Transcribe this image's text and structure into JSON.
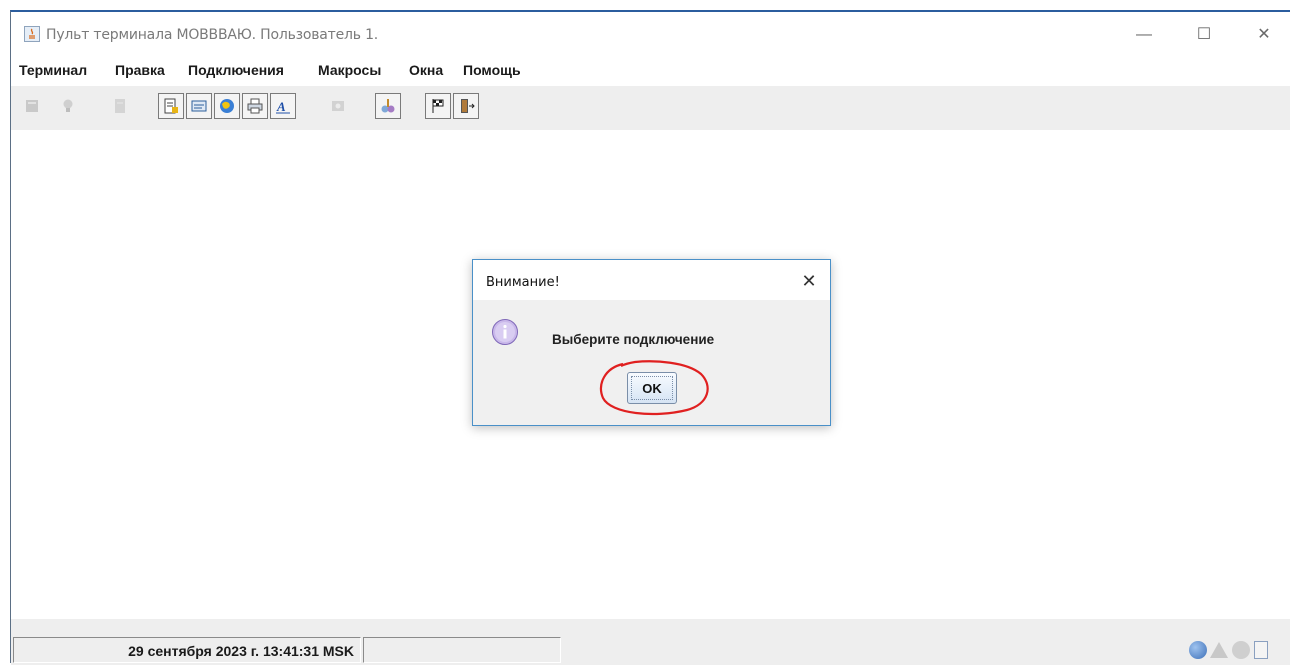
{
  "window": {
    "title": "Пульт терминала MOBBBAЮ. Пользователь 1.",
    "minimize_glyph": "—",
    "maximize_glyph": "☐",
    "close_glyph": "✕"
  },
  "menu": {
    "items": [
      "Терминал",
      "Правка",
      "Подключения",
      "Макросы",
      "Окна",
      "Помощь"
    ]
  },
  "toolbar": {
    "buttons": [
      {
        "icon": "connect-icon",
        "enabled": false
      },
      {
        "icon": "lightbulb-icon",
        "enabled": false
      },
      {
        "icon": "document-icon",
        "enabled": false
      },
      {
        "icon": "report-icon",
        "enabled": true
      },
      {
        "icon": "window-icon",
        "enabled": true
      },
      {
        "icon": "globe-icon",
        "enabled": true
      },
      {
        "icon": "printer-icon",
        "enabled": true
      },
      {
        "icon": "font-icon",
        "enabled": true
      },
      {
        "icon": "network-icon",
        "enabled": false
      },
      {
        "icon": "tools-icon",
        "enabled": true
      },
      {
        "icon": "flags-icon",
        "enabled": true
      },
      {
        "icon": "exit-icon",
        "enabled": true
      }
    ]
  },
  "status": {
    "datetime": "29 сентября 2023 г. 13:41:31 MSK",
    "icons": [
      "info-icon",
      "warning-icon",
      "error-icon",
      "log-icon"
    ]
  },
  "dialog": {
    "title": "Внимание!",
    "close_glyph": "✕",
    "message": "Выберите подключение",
    "ok_label": "OK"
  },
  "colors": {
    "accent": "#2b5d9e",
    "annotation": "#e02020"
  }
}
